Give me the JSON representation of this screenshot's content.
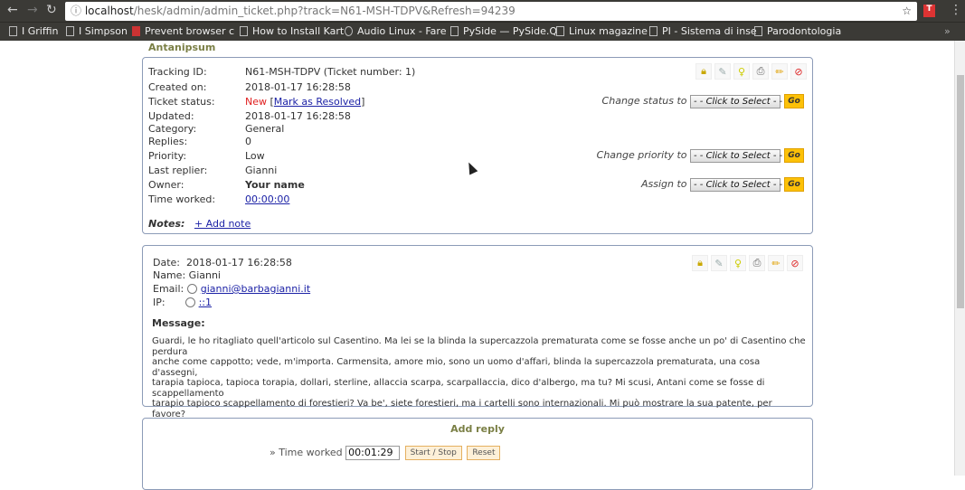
{
  "browser": {
    "url_host": "localhost",
    "url_path": "/hesk/admin/admin_ticket.php?track=N61-MSH-TDPV&Refresh=94239",
    "bookmarks": [
      "I Griffin",
      "I Simpson",
      "Prevent browser c",
      "How to Install Kart",
      "Audio Linux - Fare",
      "PySide — PySide.Q",
      "Linux magazine",
      "PI - Sistema di inse",
      "Parodontologia"
    ]
  },
  "page_title": "Antanipsum",
  "ticket": {
    "tracking_label": "Tracking ID:",
    "tracking_value": "N61-MSH-TDPV (Ticket number: 1)",
    "created_label": "Created on:",
    "created_value": "2018-01-17 16:28:58",
    "status_label": "Ticket status:",
    "status_value": "New",
    "mark_resolved": "Mark as Resolved",
    "updated_label": "Updated:",
    "updated_value": "2018-01-17 16:28:58",
    "category_label": "Category:",
    "category_value": "General",
    "replies_label": "Replies:",
    "replies_value": "0",
    "priority_label": "Priority:",
    "priority_value": "Low",
    "replier_label": "Last replier:",
    "replier_value": "Gianni",
    "owner_label": "Owner:",
    "owner_value": "Your name",
    "time_label": "Time worked:",
    "time_value": "00:00:00",
    "notes_label": "Notes:",
    "add_note": "+ Add note",
    "change_status": "Change status to",
    "change_priority": "Change priority to",
    "assign_to": "Assign to",
    "select_placeholder": "- - Click to Select - -",
    "go": "Go"
  },
  "message": {
    "date_label": "Date:",
    "date_value": "2018-01-17 16:28:58",
    "name_label": "Name:",
    "name_value": "Gianni",
    "email_label": "Email:",
    "email_value": "gianni@barbagianni.it",
    "ip_label": "IP:",
    "ip_value": "::1",
    "message_label": "Message:",
    "lines": [
      "Guardi, le ho ritagliato quell'articolo sul Casentino. Ma lei se la blinda la supercazzola prematurata come se fosse anche un po' di Casentino che perdura",
      "anche come cappotto; vede, m'importa. Carmensita, amore mio, sono un uomo d'affari, blinda la supercazzola prematurata, una cosa d'assegni,",
      "tarapia tapioca, tapioca torapia, dollari, sterline, allaccia scarpa, scarpallaccia, dico d'albergo, ma tu? Mi scusi, Antani come se fosse di scappellamento",
      "tarapio tapioco scappellamento di forestieri? Va be', siete forestieri, ma i cartelli sono internazionali. Mi può mostrare la sua patente, per favore?"
    ]
  },
  "reply": {
    "title": "Add reply",
    "time_label": "» Time worked",
    "time_value": "00:01:29",
    "start_stop": "Start / Stop",
    "reset": "Reset"
  },
  "colors": {
    "status_new": "#e02020",
    "go_button": "#fcc108",
    "title": "#7a7f45"
  }
}
